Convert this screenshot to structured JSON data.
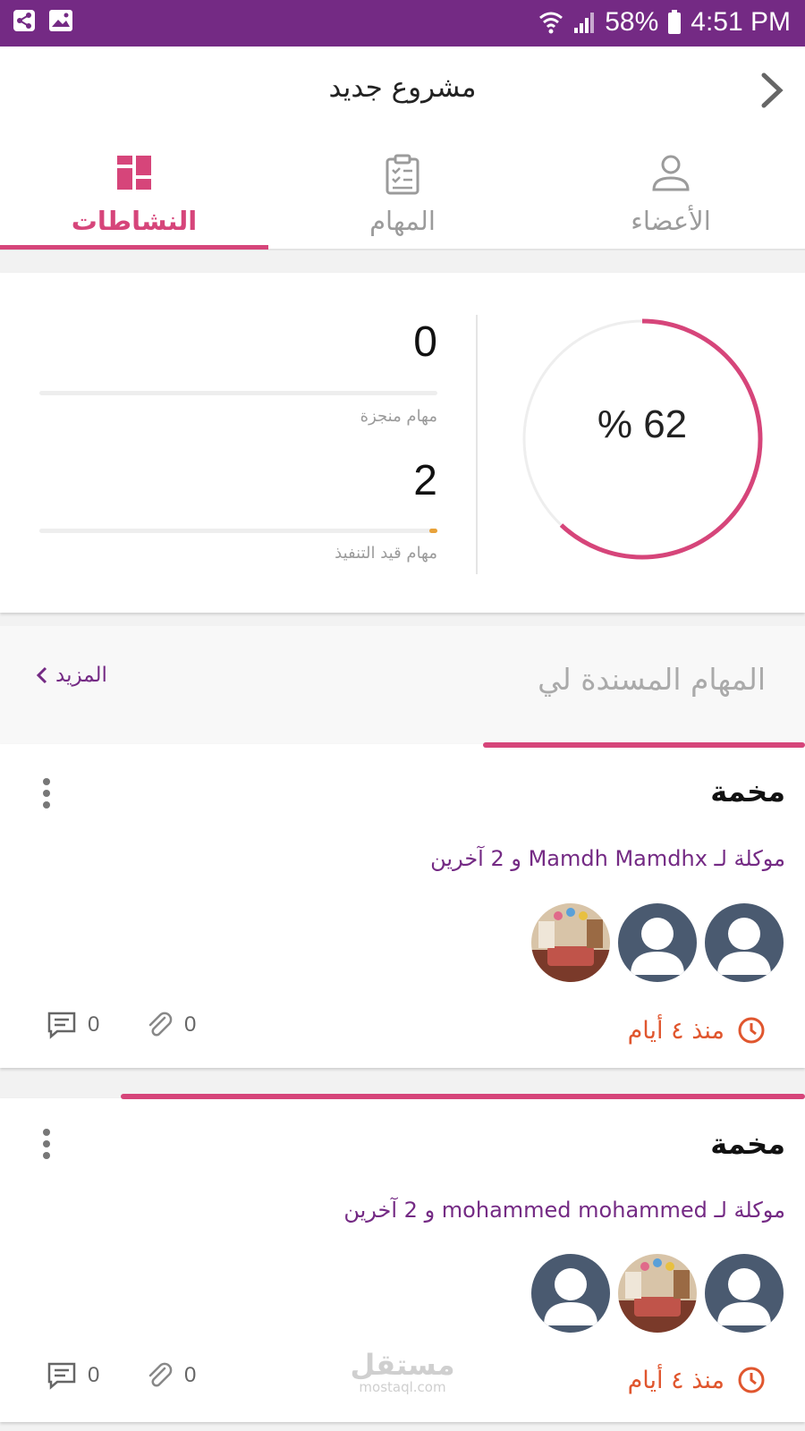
{
  "status_bar": {
    "battery": "58%",
    "time": "4:51 PM"
  },
  "header": {
    "title": "مشروع جديد"
  },
  "tabs": [
    {
      "label": "النشاطات",
      "icon": "dashboard-icon",
      "active": true
    },
    {
      "label": "المهام",
      "icon": "clipboard-icon",
      "active": false
    },
    {
      "label": "الأعضاء",
      "icon": "person-icon",
      "active": false
    }
  ],
  "summary": {
    "progress_label": "% 62",
    "progress": 0.62,
    "done_count": "0",
    "done_label": "مهام منجزة",
    "done_fill": 0,
    "inprogress_count": "2",
    "inprogress_label": "مهام قيد التنفيذ",
    "inprogress_fill": 0.02
  },
  "section": {
    "title": "المهام المسندة لي",
    "more_label": "المزيد"
  },
  "tasks": [
    {
      "title": "مخمة",
      "assigned": "موكلة لـ Mamdh Mamdhx و 2 آخرين",
      "time": "منذ ٤ أيام",
      "attachments": "0",
      "comments": "0",
      "avatars": [
        "default-avatar",
        "default-avatar",
        "photo-avatar"
      ]
    },
    {
      "title": "مخمة",
      "assigned": "موكلة لـ mohammed mohammed و 2 آخرين",
      "time": "منذ ٤ أيام",
      "attachments": "0",
      "comments": "0",
      "avatars": [
        "default-avatar",
        "photo-avatar",
        "default-avatar"
      ]
    }
  ],
  "watermark": {
    "brand": "مستقل",
    "domain": "mostaql.com"
  },
  "colors": {
    "accent": "#d6457a",
    "purple": "#742a84",
    "time": "#e0562e",
    "avatar_bg": "#4a5a70"
  }
}
